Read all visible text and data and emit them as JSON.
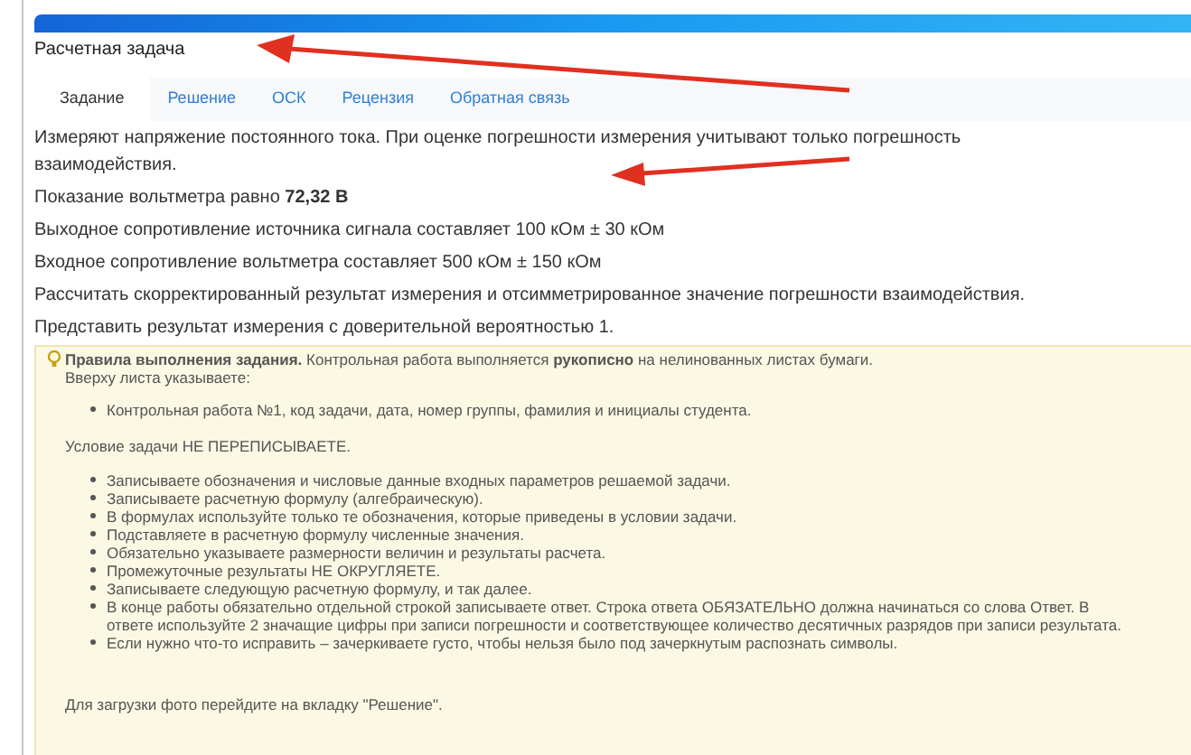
{
  "title": "Расчетная задача",
  "tabs": [
    {
      "label": "Задание",
      "selected": true
    },
    {
      "label": "Решение",
      "selected": false
    },
    {
      "label": "ОСК",
      "selected": false
    },
    {
      "label": "Рецензия",
      "selected": false
    },
    {
      "label": "Обратная связь",
      "selected": false
    }
  ],
  "task_lines": [
    "Измеряют напряжение постоянного тока. При оценке погрешности измерения учитывают только погрешность взаимодействия.",
    "Показание вольтметра равно **72,32 В**",
    "Выходное сопротивление источника сигнала составляет 100 кОм ± 30 кОм",
    "Входное сопротивление вольтметра составляет 500 кОм ± 150 кОм",
    "Рассчитать скорректированный результат измерения и отсимметрированное значение погрешности взаимодействия.",
    "Представить результат измерения с доверительной вероятностью 1."
  ],
  "rules": {
    "heading": "**Правила выполнения задания.** Контрольная работа выполняется **рукописно** на нелинованных листах бумаги.",
    "top_label": "Вверху листа указываете:",
    "top_items": [
      "Контрольная работа №1, код задачи, дата, номер группы, фамилия и инициалы студента."
    ],
    "steps_label": "Условие задачи НЕ ПЕРЕПИСЫВАЕТЕ.",
    "steps": [
      "Записываете обозначения и числовые данные входных параметров решаемой задачи.",
      "Записываете расчетную формулу (алгебраическую).",
      "В формулах используйте только те обозначения, которые приведены в условии задачи.",
      "Подставляете в расчетную формулу численные значения.",
      "Обязательно указываете размерности величин и результаты расчета.",
      "Промежуточные результаты НЕ ОКРУГЛЯЕТЕ.",
      "Записываете следующую расчетную формулу, и так далее.",
      "В конце работы обязательно отдельной строкой записываете ответ. Строка ответа ОБЯЗАТЕЛЬНО должна начинаться со слова Ответ. В ответе используйте 2 значащие цифры при записи погрешности и соответствующее количество десятичных разрядов при записи результата.",
      "Если нужно что-то исправить – зачеркиваете густо, чтобы нельзя было под зачеркнутым распознать символы."
    ],
    "footer": "Для загрузки фото перейдите на вкладку \"Решение\"."
  }
}
